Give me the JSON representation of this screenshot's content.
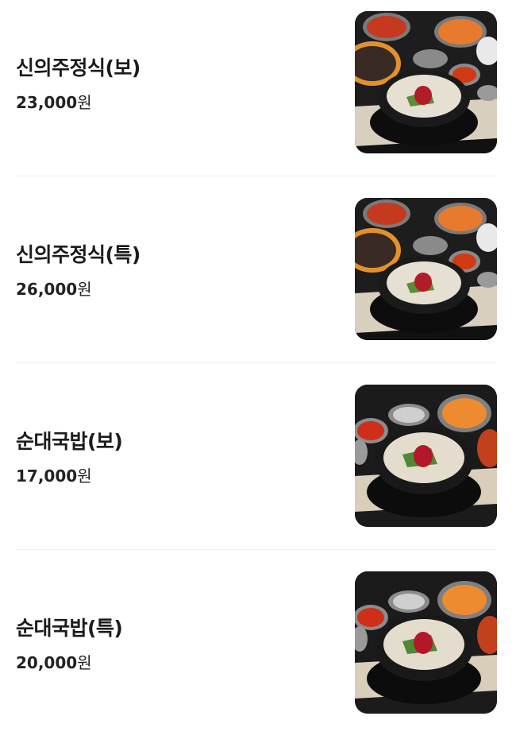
{
  "menu_items": [
    {
      "name": "신의주정식(보)",
      "price": "23,000",
      "currency": "원",
      "image_icon": "set-meal-photo"
    },
    {
      "name": "신의주정식(특)",
      "price": "26,000",
      "currency": "원",
      "image_icon": "set-meal-photo"
    },
    {
      "name": "순대국밥(보)",
      "price": "17,000",
      "currency": "원",
      "image_icon": "soup-photo"
    },
    {
      "name": "순대국밥(특)",
      "price": "20,000",
      "currency": "원",
      "image_icon": "soup-photo"
    }
  ]
}
